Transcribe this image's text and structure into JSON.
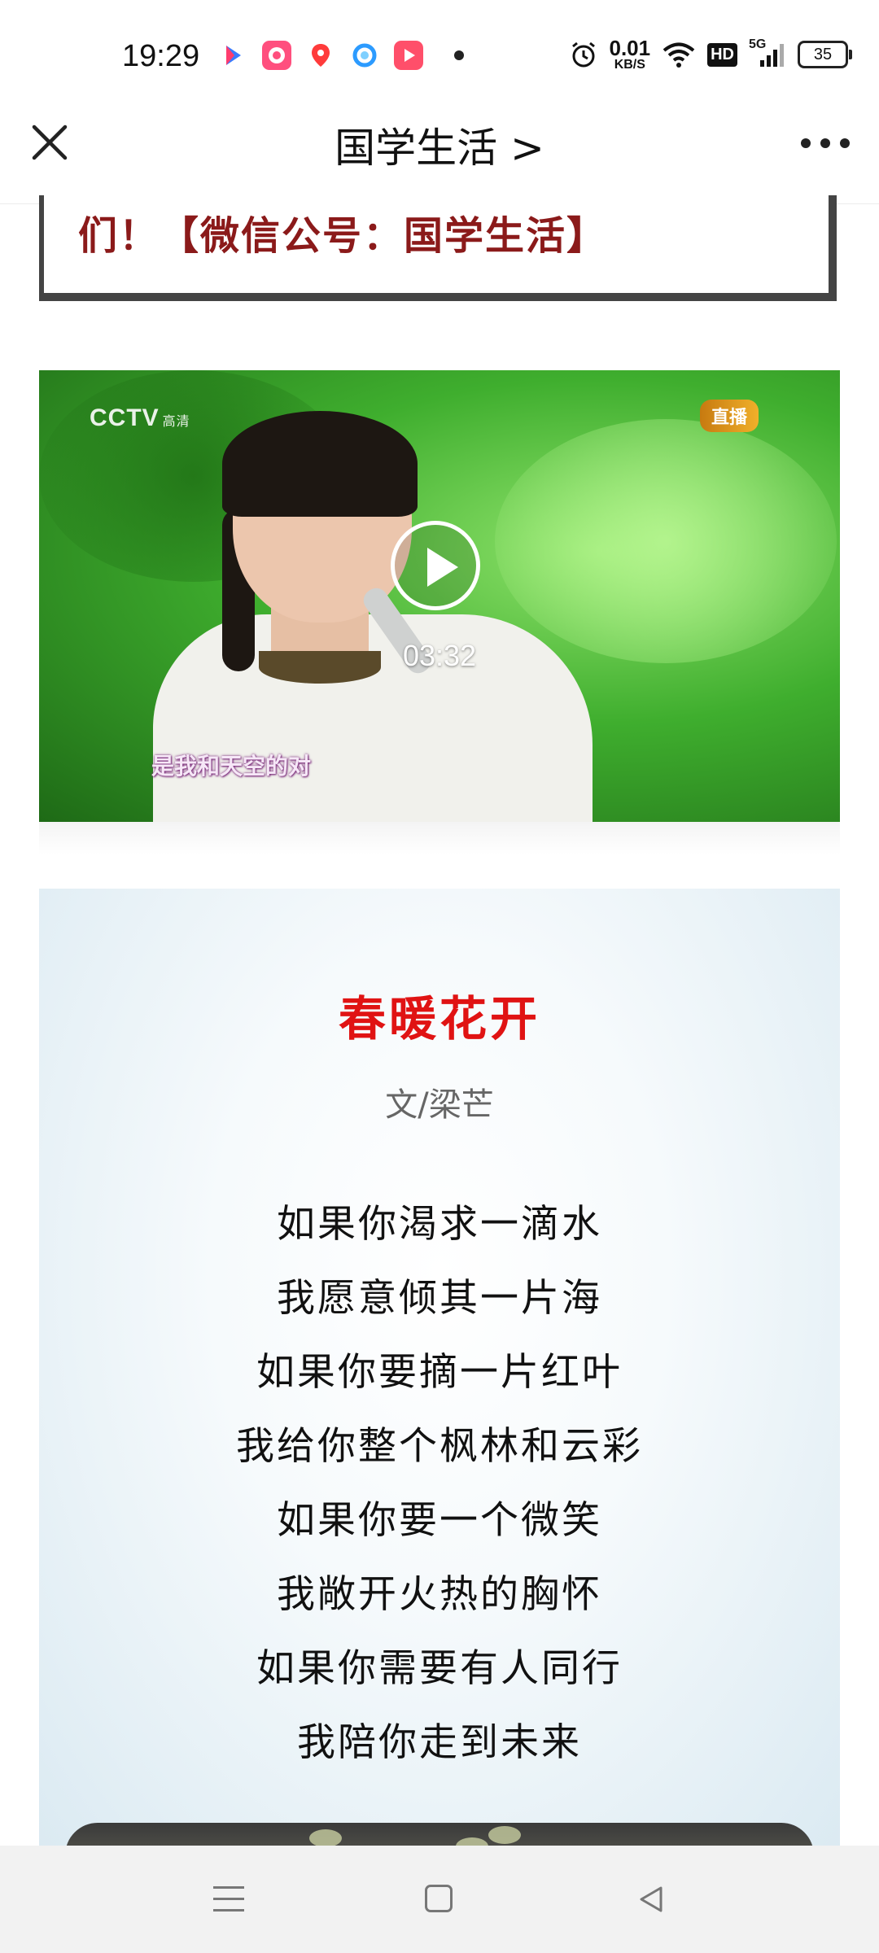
{
  "status_bar": {
    "time": "19:29",
    "speed_value": "0.01",
    "speed_unit": "KB/S",
    "hd": "HD",
    "network": "5G",
    "battery": "35",
    "app_icons": [
      "youku-icon",
      "fengyun-icon",
      "map-pin-app-icon",
      "qq-browser-icon",
      "video-app-icon"
    ]
  },
  "nav": {
    "title": "国学生活 >"
  },
  "article": {
    "quote_text": "们！【微信公号：国学生活】",
    "video": {
      "duration": "03:32",
      "watermark": "CCTV",
      "watermark_sub": "高清",
      "live_badge": "直播",
      "subtitle": "是我和天空的对"
    },
    "poem": {
      "title": "春暖花开",
      "author": "文/梁芒",
      "lines": [
        "如果你渴求一滴水",
        "我愿意倾其一片海",
        "如果你要摘一片红叶",
        "我给你整个枫林和云彩",
        "如果你要一个微笑",
        "我敞开火热的胸怀",
        "如果你需要有人同行",
        "我陪你走到未来"
      ]
    }
  },
  "colors": {
    "poem_title": "#e01313",
    "quote_text": "#8b1a1a"
  }
}
